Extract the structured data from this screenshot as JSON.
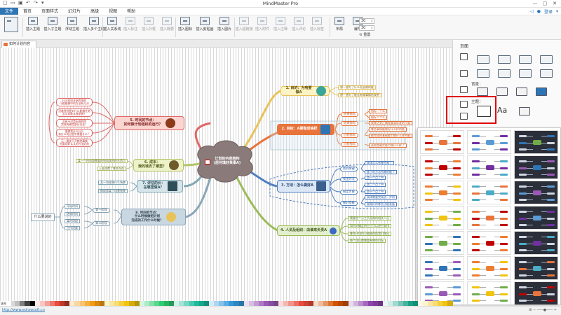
{
  "app_title": "MindMaster Pro",
  "quick_access_icons": [
    "new-file-icon",
    "open-folder-icon",
    "save-icon",
    "undo-icon",
    "redo-icon",
    "more-icon"
  ],
  "login_label": "登录",
  "menu": [
    {
      "label": "文件",
      "active": true
    },
    {
      "label": "首页",
      "active": false
    },
    {
      "label": "页面样式",
      "active": false
    },
    {
      "label": "幻灯片",
      "active": false
    },
    {
      "label": "高级",
      "active": false
    },
    {
      "label": "视图",
      "active": false
    },
    {
      "label": "帮助",
      "active": false
    }
  ],
  "ribbon": {
    "topic_buttons": [
      "插入主题",
      "插入子主题",
      "浮动主题",
      "插入多个主题"
    ],
    "relation_buttons": [
      "插入关系线",
      "插入标注",
      "插入外框",
      "插入概要"
    ],
    "media_buttons": [
      "插入图标",
      "插入剪贴画",
      "插入图片"
    ],
    "disabled_buttons": [
      "插入超链接",
      "插入附件",
      "插入注释",
      "插入评论",
      "插入标签"
    ],
    "layout_buttons": [
      "布局",
      "编号"
    ],
    "spin1": "30",
    "spin2": "30",
    "reset_label": "重置"
  },
  "doc_tab": "如何计划内容",
  "center_node": {
    "line1": "计划的内容结构",
    "line2": "(居何填好某事A)"
  },
  "topics": [
    {
      "id": "t1",
      "label": "1. 目的：为啥要做A",
      "leaves": [
        "想一想为了什么而去做的能",
        "想一想为了能去有做事情给我带"
      ]
    },
    {
      "id": "t2",
      "label": "2. 目标：A要做成啥样",
      "subs": [
        "结果指标",
        "结果指标",
        "过程指标",
        "过程指标"
      ],
      "leaves": [
        "指标一个么",
        "指标二个么",
        "成果达到正确程度或标准的尺度",
        "哪些事情能做好什么样的能",
        "能完成的基础能力做什么样的能",
        "选取是确实能力做什么样了"
      ]
    },
    {
      "id": "t3",
      "label": "3. 方法：怎么做好A",
      "subs": [
        "找到关键",
        "找出办法",
        "制定步骤",
        "做好准备"
      ],
      "leaves": [
        "具体怎么有哪些难了",
        "基于的方法所需的能了",
        "第一个点了中",
        "第二个点了中",
        "第十个点了中",
        "具体需要完成进一步的",
        "要做好的哪些功能准备"
      ]
    },
    {
      "id": "t4",
      "label": "4. 人员及组织：由谁来负责A",
      "leaves": [
        "需要定个分工负责做的相关人员",
        "如何对确定的分工可以进行安排",
        "哪些环境的可能能帮助我们做出",
        "每个团队都需要有哪些目标"
      ]
    },
    {
      "id": "t5",
      "label": "5. 时间的节点：\n如何做计划组织的运行？",
      "leaves": [
        "什么时间开始完成的\n可能能做中的方法有几分",
        "活着经验是对什么能做任务\n怎么对能从哪里做？",
        "没有不对是无限到终\n完成的确定部分分支？",
        "要做到什么什么\n有什么的过程中需要什么？",
        "无一要发下开都到事情\n先要同好认认的方法好的"
      ]
    },
    {
      "id": "t6",
      "label": "6. 成本：\n我的钱去了哪里？",
      "leaves": [
        "某一个时间段需要的钱和其他的东西可",
        "上面花费了哪些东西"
      ]
    },
    {
      "id": "t7",
      "label": "7. 评估的价：\n在哪里做A？",
      "leaves": [
        "某一项经营什么场景",
        "做成第某个场景效果"
      ]
    },
    {
      "id": "t8",
      "label": "8. 时间的节点：\n什么时候做组计划\n完成的工作什么时候？",
      "subs": [
        "开始时间",
        "结束时间",
        "某时间段",
        "工作进度"
      ],
      "leaves": [
        "第一阶段",
        "第二阶段"
      ]
    }
  ],
  "floating_label": "什么要说的",
  "panel": {
    "header": "页面",
    "background_label": "背景：",
    "theme_label": "主题：",
    "font_glyph": "Aa"
  },
  "theme_gallery": {
    "columns": 3,
    "rows": 7,
    "dark_column_color": "#2b2f3a",
    "accent_colors": [
      "#e8743b",
      "#5b9bd5",
      "#70ad47",
      "#c00000",
      "#7030a0",
      "#2e75b6",
      "#ed7d31",
      "#4bacc6",
      "#9b59b6",
      "#f1c40f"
    ]
  },
  "color_strip": {
    "label": "填充",
    "colors": [
      "#ffffff",
      "#f2f2f2",
      "#d9d9d9",
      "#bfbfbf",
      "#808080",
      "#404040",
      "#000000",
      "#fde9e8",
      "#f9c6c3",
      "#f4a09b",
      "#ee776f",
      "#e74c3c",
      "#c0392b",
      "#922b21",
      "#fdebd0",
      "#fad7a0",
      "#f8c471",
      "#f5b041",
      "#f39c12",
      "#d68910",
      "#b9770e",
      "#fcf3cf",
      "#f9e79f",
      "#f7dc6f",
      "#f4d03f",
      "#f1c40f",
      "#d4ac0d",
      "#b7950b",
      "#d5f5e3",
      "#abebc6",
      "#82e0aa",
      "#58d68d",
      "#2ecc71",
      "#28b463",
      "#239b56",
      "#d1f2eb",
      "#a3e4d7",
      "#76d7c4",
      "#48c9b0",
      "#1abc9c",
      "#17a589",
      "#148f77",
      "#d6eaf8",
      "#aed6f1",
      "#85c1e9",
      "#5dade2",
      "#3498db",
      "#2e86c1",
      "#2874a6",
      "#ebdef0",
      "#d7bde2",
      "#c39bd3",
      "#af7ac5",
      "#9b59b6",
      "#884ea0",
      "#76448a",
      "#fadbd8",
      "#f5b7b1",
      "#f1948a",
      "#ec7063",
      "#e74c3c",
      "#cb4335",
      "#b03a2e",
      "#f6ddcc",
      "#edbb99",
      "#e59866",
      "#dc7633",
      "#d35400",
      "#ba4a00",
      "#a04000",
      "#e8daef",
      "#d2b4de",
      "#bb8fce",
      "#a569bd",
      "#8e44ad",
      "#7d3c98",
      "#6c3483",
      "#e8f8f5",
      "#d0ece7",
      "#a2d9ce",
      "#73c6b6",
      "#45b39d",
      "#16a085",
      "#138d75",
      "#fef9e7",
      "#fcf3cf",
      "#f9e79f",
      "#f7dc6f",
      "#f4d03f",
      "#f1c40f",
      "#d4ac0d"
    ]
  },
  "status_url": "http://www.edrawsoft.cn"
}
